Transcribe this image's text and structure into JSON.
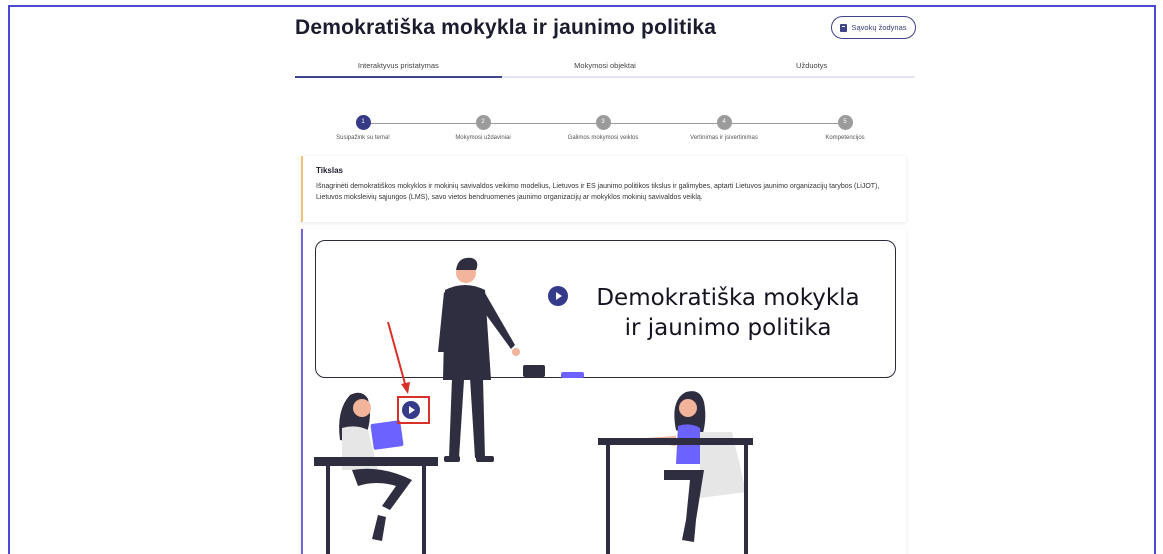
{
  "page": {
    "title": "Demokratiška mokykla ir jaunimo politika",
    "glossary_button": "Sąvokų žodynas"
  },
  "tabs": [
    {
      "label": "Interaktyvus pristatymas",
      "active": true
    },
    {
      "label": "Mokymosi objektai",
      "active": false
    },
    {
      "label": "Užduotys",
      "active": false
    }
  ],
  "stepper": [
    {
      "number": "1",
      "label": "Susipažink su tema!",
      "active": true
    },
    {
      "number": "2",
      "label": "Mokymosi uždaviniai",
      "active": false
    },
    {
      "number": "3",
      "label": "Galimos mokymosi veiklos",
      "active": false
    },
    {
      "number": "4",
      "label": "Vertinimas ir įsivertinimas",
      "active": false
    },
    {
      "number": "5",
      "label": "Kompetencijos",
      "active": false
    }
  ],
  "goal": {
    "title": "Tikslas",
    "text": "Išnagrinėti demokratiškos mokyklos ir mokinių savivaldos veikimo modelius, Lietuvos ir ES jaunimo politikos tikslus ir galimybes, aptarti Lietuvos jaunimo organizacijų tarybos (LiJOT), Lietuvos moksleivių sąjungos (LMS), savo vietos bendruomenės jaunimo organizacijų ar mokyklos mokinių savivaldos veiklą."
  },
  "video": {
    "banner_title": "Demokratiška mokykla ir jaunimo politika"
  },
  "colors": {
    "accent": "#373b86",
    "annotation": "#d9302a",
    "goal_border": "#f0c27a",
    "content_border": "#6f66d8",
    "illustration_figure": "#2f2e41",
    "illustration_accent": "#6c63ff"
  }
}
